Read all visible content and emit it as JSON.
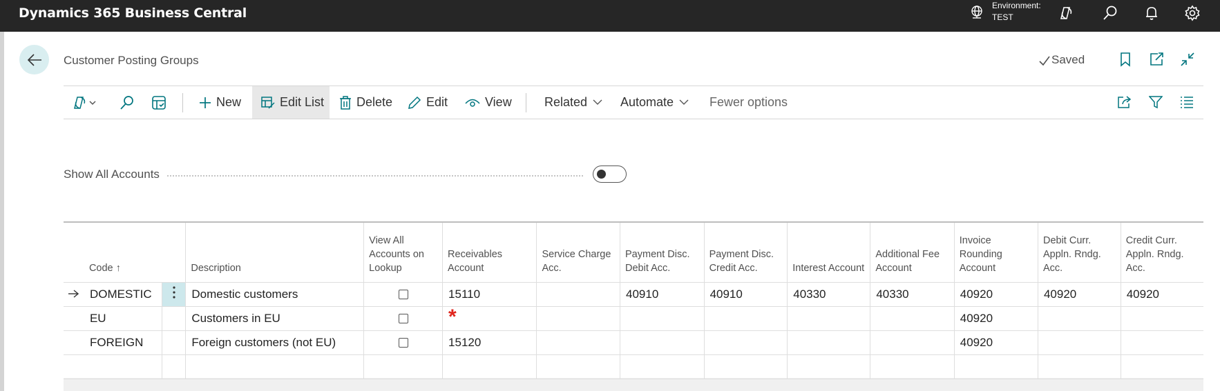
{
  "app": {
    "title": "Dynamics 365 Business Central"
  },
  "environment": {
    "label": "Environment:",
    "value": "TEST"
  },
  "page": {
    "title": "Customer Posting Groups",
    "status": "Saved"
  },
  "actions": {
    "new": "New",
    "edit_list": "Edit List",
    "delete": "Delete",
    "edit": "Edit",
    "view": "View",
    "related": "Related",
    "automate": "Automate",
    "fewer_options": "Fewer options"
  },
  "filter": {
    "show_all_accounts_label": "Show All Accounts",
    "show_all_accounts_value": false
  },
  "table": {
    "columns": [
      {
        "key": "code",
        "label": "Code ↑"
      },
      {
        "key": "description",
        "label": "Description"
      },
      {
        "key": "view_all",
        "label": "View All Accounts on Lookup"
      },
      {
        "key": "receivables",
        "label": "Receivables Account"
      },
      {
        "key": "service_charge",
        "label": "Service Charge Acc."
      },
      {
        "key": "pmt_debit",
        "label": "Payment Disc. Debit Acc."
      },
      {
        "key": "pmt_credit",
        "label": "Payment Disc. Credit Acc."
      },
      {
        "key": "interest",
        "label": "Interest Account"
      },
      {
        "key": "additional_fee",
        "label": "Additional Fee Account"
      },
      {
        "key": "invoice_rounding",
        "label": "Invoice Rounding Account"
      },
      {
        "key": "debit_curr",
        "label": "Debit Curr. Appln. Rndg. Acc."
      },
      {
        "key": "credit_curr",
        "label": "Credit Curr. Appln. Rndg. Acc."
      }
    ],
    "rows": [
      {
        "code": "DOMESTIC",
        "description": "Domestic customers",
        "view_all": false,
        "receivables": "15110",
        "service_charge": "",
        "pmt_debit": "40910",
        "pmt_credit": "40910",
        "interest": "40330",
        "additional_fee": "40330",
        "invoice_rounding": "40920",
        "debit_curr": "40920",
        "credit_curr": "40920"
      },
      {
        "code": "EU",
        "description": "Customers in EU",
        "view_all": false,
        "receivables": "",
        "receivables_required": true,
        "service_charge": "",
        "pmt_debit": "",
        "pmt_credit": "",
        "interest": "",
        "additional_fee": "",
        "invoice_rounding": "40920",
        "debit_curr": "",
        "credit_curr": ""
      },
      {
        "code": "FOREIGN",
        "description": "Foreign customers (not EU)",
        "view_all": false,
        "receivables": "15120",
        "service_charge": "",
        "pmt_debit": "",
        "pmt_credit": "",
        "interest": "",
        "additional_fee": "",
        "invoice_rounding": "40920",
        "debit_curr": "",
        "credit_curr": ""
      }
    ],
    "required_marker": "*"
  },
  "colors": {
    "topbar": "#262626",
    "accent": "#00757f",
    "selected": "#cde8ec",
    "required": "#e0261e"
  }
}
